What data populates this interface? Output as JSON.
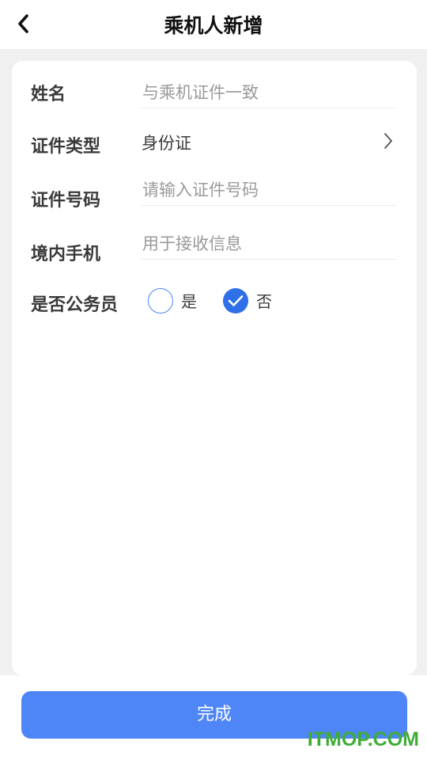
{
  "header": {
    "title": "乘机人新增",
    "back_icon": "chevron-left-icon"
  },
  "form": {
    "name": {
      "label": "姓名",
      "placeholder": "与乘机证件一致",
      "value": ""
    },
    "id_type": {
      "label": "证件类型",
      "value": "身份证",
      "icon": "chevron-right-icon"
    },
    "id_number": {
      "label": "证件号码",
      "placeholder": "请输入证件号码",
      "value": ""
    },
    "phone": {
      "label": "境内手机",
      "placeholder": "用于接收信息",
      "value": ""
    },
    "civil_servant": {
      "label": "是否公务员",
      "options": [
        {
          "label": "是",
          "selected": false
        },
        {
          "label": "否",
          "selected": true
        }
      ]
    }
  },
  "footer": {
    "done_label": "完成"
  },
  "watermark": "ITMOP.COM",
  "colors": {
    "accent": "#2f6fe8",
    "button": "#4f86f7",
    "watermark": "#3fad35"
  }
}
